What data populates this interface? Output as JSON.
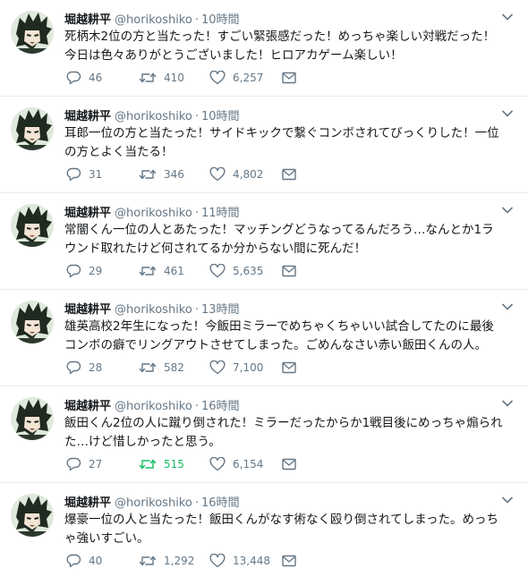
{
  "colors": {
    "text": "#14171a",
    "secondary": "#657786",
    "border": "#e6ecf0",
    "retweet_active": "#17bf63"
  },
  "icons": {
    "reply": "reply-icon",
    "retweet": "retweet-icon",
    "like": "heart-icon",
    "dm": "envelope-icon",
    "menu": "chevron-down-icon"
  },
  "tweets": [
    {
      "name": "堀越耕平",
      "handle": "@horikoshiko",
      "dot": "·",
      "time": "10時間",
      "line1": "死柄木2位の方と当たった！すごい緊張感だった！めっちゃ楽しい対戦だった！",
      "line2": "今日は色々ありがとうございました！ヒロアカゲーム楽しい！",
      "replies": "46",
      "retweets": "410",
      "likes": "6,257",
      "retweeted": false
    },
    {
      "name": "堀越耕平",
      "handle": "@horikoshiko",
      "dot": "·",
      "time": "10時間",
      "line1": "耳郎一位の方と当たった！サイドキックで繋ぐコンボされてびっくりした！一位",
      "line2": "の方とよく当たる！",
      "replies": "31",
      "retweets": "346",
      "likes": "4,802",
      "retweeted": false
    },
    {
      "name": "堀越耕平",
      "handle": "@horikoshiko",
      "dot": "·",
      "time": "11時間",
      "line1": "常闇くん一位の人とあたった！マッチングどうなってるんだろう…なんとか1ラ",
      "line2": "ウンド取れたけど何されてるか分からない間に死んだ！",
      "replies": "29",
      "retweets": "461",
      "likes": "5,635",
      "retweeted": false
    },
    {
      "name": "堀越耕平",
      "handle": "@horikoshiko",
      "dot": "·",
      "time": "13時間",
      "line1": "雄英高校2年生になった！今飯田ミラーでめちゃくちゃいい試合してたのに最後",
      "line2": "コンボの癖でリングアウトさせてしまった。ごめんなさい赤い飯田くんの人。",
      "replies": "28",
      "retweets": "582",
      "likes": "7,100",
      "retweeted": false
    },
    {
      "name": "堀越耕平",
      "handle": "@horikoshiko",
      "dot": "·",
      "time": "16時間",
      "line1": "飯田くん2位の人に蹴り倒された！ミラーだったからか1戦目後にめっちゃ煽られ",
      "line2": "た…けど惜しかったと思う。",
      "replies": "27",
      "retweets": "515",
      "likes": "6,154",
      "retweeted": true
    },
    {
      "name": "堀越耕平",
      "handle": "@horikoshiko",
      "dot": "·",
      "time": "16時間",
      "line1": "爆豪一位の人と当たった！飯田くんがなす術なく殴り倒されてしまった。めっち",
      "line2": "ゃ強いすごい。",
      "replies": "40",
      "retweets": "1,292",
      "likes": "13,448",
      "retweeted": false
    }
  ]
}
